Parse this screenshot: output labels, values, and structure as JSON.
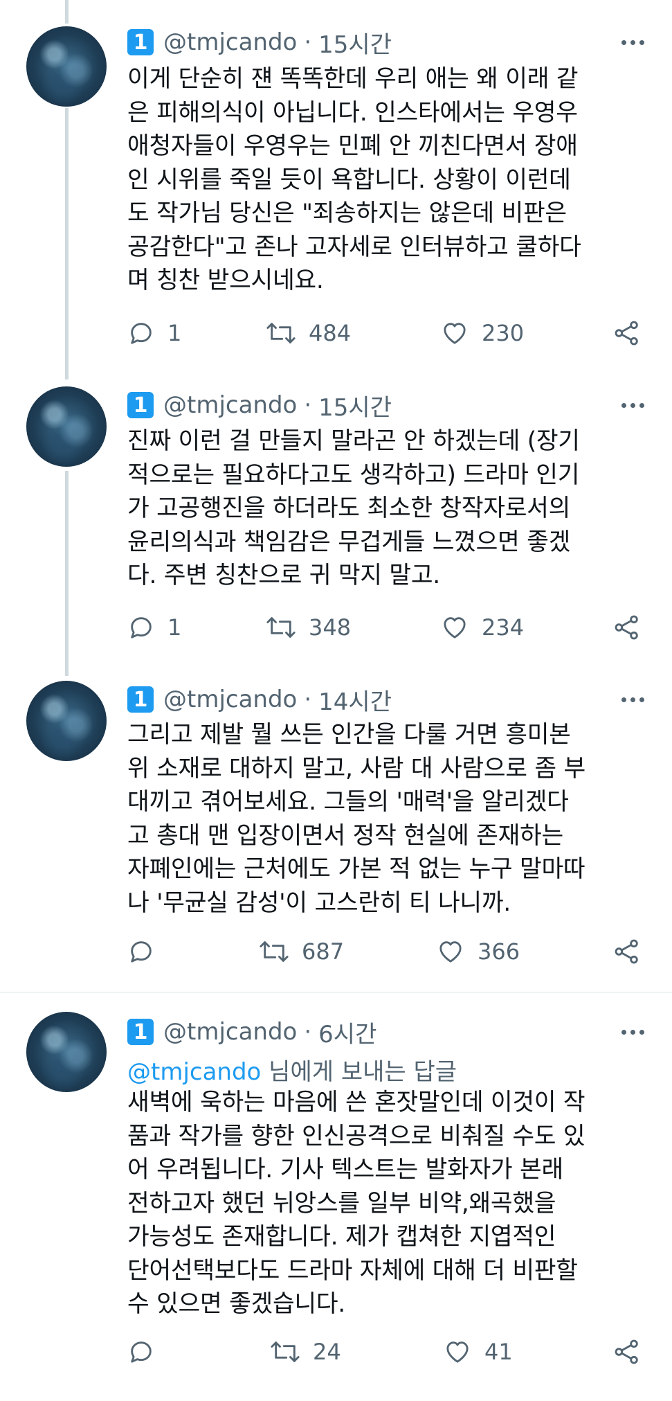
{
  "tweets": [
    {
      "badge": "1",
      "handle": "@tmjcando",
      "time": "15시간",
      "reply_mention": "",
      "reply_suffix": "",
      "lines": [
        "이게 단순히 쟨 똑똑한데 우리 애는 왜 이래 같",
        "은 피해의식이 아닙니다. 인스타에서는 우영우",
        "애청자들이 우영우는 민폐 안 끼친다면서 장애",
        "인 시위를 죽일 듯이 욕합니다. 상황이 이런데",
        "도 작가님 당신은 \"죄송하지는 않은데 비판은",
        "공감한다\"고 존나 고자세로 인터뷰하고 쿨하다",
        "며 칭찬 받으시네요."
      ],
      "replies": "1",
      "retweets": "484",
      "likes": "230"
    },
    {
      "badge": "1",
      "handle": "@tmjcando",
      "time": "15시간",
      "reply_mention": "",
      "reply_suffix": "",
      "lines": [
        "진짜 이런 걸 만들지 말라곤 안 하겠는데 (장기",
        "적으로는 필요하다고도 생각하고) 드라마 인기",
        "가 고공행진을 하더라도 최소한 창작자로서의",
        "윤리의식과 책임감은 무겁게들 느꼈으면 좋겠",
        "다. 주변 칭찬으로 귀 막지 말고."
      ],
      "replies": "1",
      "retweets": "348",
      "likes": "234"
    },
    {
      "badge": "1",
      "handle": "@tmjcando",
      "time": "14시간",
      "reply_mention": "",
      "reply_suffix": "",
      "lines": [
        "그리고 제발 뭘 쓰든 인간을 다룰 거면 흥미본",
        "위 소재로 대하지 말고, 사람 대 사람으로 좀 부",
        "대끼고 겪어보세요. 그들의 '매력'을 알리겠다",
        "고 총대 맨 입장이면서 정작 현실에 존재하는",
        "자폐인에는 근처에도 가본 적 없는 누구 말마따",
        "나 '무균실 감성'이 고스란히 티 나니까."
      ],
      "replies": "",
      "retweets": "687",
      "likes": "366"
    },
    {
      "badge": "1",
      "handle": "@tmjcando",
      "time": "6시간",
      "reply_mention": "@tmjcando",
      "reply_suffix": " 님에게 보내는 답글",
      "lines": [
        "새벽에 욱하는 마음에 쓴 혼잣말인데 이것이 작",
        "품과 작가를 향한 인신공격으로 비춰질 수도 있",
        "어 우려됩니다. 기사 텍스트는 발화자가 본래",
        "전하고자 했던 뉘앙스를 일부 비약,왜곡했을",
        "가능성도 존재합니다. 제가 캡쳐한 지엽적인",
        "단어선택보다도 드라마 자체에 대해 더 비판할",
        "수 있으면 좋겠습니다."
      ],
      "replies": "",
      "retweets": "24",
      "likes": "41"
    }
  ],
  "header_separator": "·",
  "colors": {
    "text": "#0f1419",
    "muted": "#536471",
    "accent": "#1d9bf0",
    "thread_line": "#cfd9de",
    "divider": "#eff3f4"
  },
  "icons": [
    "more-icon",
    "reply-icon",
    "retweet-icon",
    "like-icon",
    "share-icon"
  ]
}
